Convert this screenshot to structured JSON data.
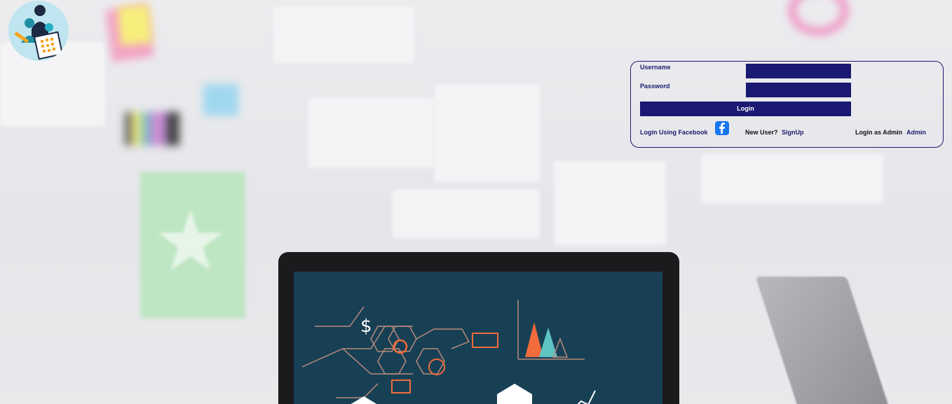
{
  "login": {
    "username_label": "Username",
    "password_label": "Password",
    "username_value": "",
    "password_value": "",
    "login_button": "Login",
    "facebook_link": "Login Using Facebook",
    "new_user_prefix": "New User?",
    "signup_link": "SignUp",
    "admin_prefix": "Login as Admin",
    "admin_link": "Admin"
  },
  "icons": {
    "logo": "team-schedule-logo-icon",
    "facebook": "facebook-icon"
  },
  "colors": {
    "navy": "#1a1a72",
    "screen": "#174055",
    "accent_orange": "#f26b3a",
    "accent_teal": "#5ec4c2"
  }
}
